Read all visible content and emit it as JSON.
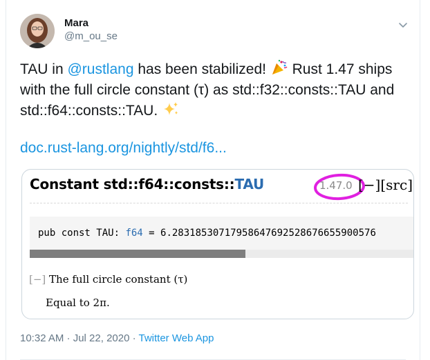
{
  "author": {
    "name": "Mara",
    "handle": "@m_ou_se"
  },
  "tweet": {
    "text_part1": "TAU in ",
    "mention": "@rustlang",
    "text_part2": " has been stabilized! ",
    "text_part3": " Rust 1.47 ships with the full circle constant (τ) as std::f32::consts::TAU and std::f64::consts::TAU. ",
    "link": "doc.rust-lang.org/nightly/std/f6..."
  },
  "card": {
    "title_prefix": "Constant std::f64::consts::",
    "title_name": "TAU",
    "version": "1.47.0",
    "src": "[−][src]",
    "code_prefix": "pub const TAU: ",
    "code_type": "f64",
    "code_suffix": " = 6.28318530717958647692528676655900576",
    "scroll_fraction": 0.56,
    "toggle": "[−]",
    "description": " The full circle constant (τ)",
    "equal": "Equal to 2π."
  },
  "meta": {
    "time": "10:32 AM · Jul 22, 2020 · ",
    "app": "Twitter Web App"
  },
  "colors": {
    "link": "#1b95e0",
    "highlight_circle": "#e020e0",
    "type_blue": "#2b6cb0"
  },
  "icons": {
    "more": "chevron-down-icon",
    "party": "party-popper-icon",
    "sparkles": "sparkles-icon"
  }
}
